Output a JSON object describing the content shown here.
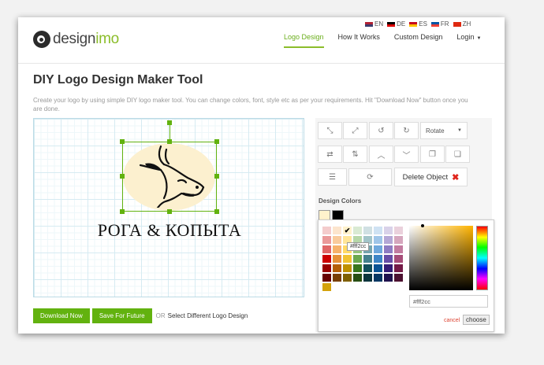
{
  "languages": [
    {
      "code": "EN",
      "colors": [
        "#b22234",
        "#3c3b6e"
      ]
    },
    {
      "code": "DE",
      "colors": [
        "#000000",
        "#dd0000"
      ]
    },
    {
      "code": "ES",
      "colors": [
        "#c60b1e",
        "#ffc400"
      ]
    },
    {
      "code": "FR",
      "colors": [
        "#0055a4",
        "#ef4135"
      ]
    },
    {
      "code": "ZH",
      "colors": [
        "#de2910",
        "#de2910"
      ]
    }
  ],
  "brand": {
    "part1": "design",
    "part2": "imo",
    "color_primary": "#444444",
    "color_accent": "#8bbd2a"
  },
  "nav": {
    "items": [
      "Logo Design",
      "How It Works",
      "Custom Design",
      "Login"
    ],
    "active": 0
  },
  "page": {
    "title": "DIY Logo Design Maker Tool",
    "description": "Create your logo by using simple DIY logo maker tool. You can change colors, font, style etc as per your requirements. Hit \"Download Now\" button once you are done."
  },
  "canvas": {
    "logo_text": "РОГА & КОПЫТА",
    "ellipse_color": "#fff2cc"
  },
  "buttons": {
    "download": "Download Now",
    "save": "Save For Future",
    "or": "OR",
    "select_different": "Select Different Logo Design"
  },
  "toolbar": {
    "rotate_label": "Rotate",
    "delete_label": "Delete Object",
    "icons": [
      "shrink-icon",
      "expand-icon",
      "rotate-left-icon",
      "rotate-right-icon",
      "flip-horizontal-icon",
      "flip-vertical-icon",
      "move-up-icon",
      "move-down-icon",
      "bring-forward-icon",
      "send-backward-icon",
      "align-center-icon",
      "refresh-icon"
    ]
  },
  "design_colors": {
    "label": "Design Colors",
    "swatches": [
      "#fff2cc",
      "#000000"
    ]
  },
  "color_picker": {
    "tooltip": "#fff2cc",
    "hex_value": "#fff2cc",
    "cancel": "cancel",
    "choose": "choose",
    "palette": [
      "#f4cccc",
      "#fce5cd",
      "#fff2cc",
      "#d9ead3",
      "#d0e0e3",
      "#cfe2f3",
      "#d9d2e9",
      "#ead1dc",
      "#ea9999",
      "#f9cb9c",
      "#ffe599",
      "#b6d7a8",
      "#a2c4c9",
      "#9fc5e8",
      "#b4a7d6",
      "#d5a6bd",
      "#e06666",
      "#f6b26b",
      "#ffd966",
      "#93c47d",
      "#76a5af",
      "#6fa8dc",
      "#8e7cc3",
      "#c27ba0",
      "#cc0000",
      "#e69138",
      "#f1c232",
      "#6aa84f",
      "#45818e",
      "#3d85c6",
      "#674ea7",
      "#a64d79",
      "#990000",
      "#b45f06",
      "#bf9000",
      "#38761d",
      "#134f5c",
      "#0b5394",
      "#351c75",
      "#741b47",
      "#660000",
      "#783f04",
      "#7f6000",
      "#274e13",
      "#0c343d",
      "#073763",
      "#20124d",
      "#4c1130",
      "#d4a20c"
    ],
    "selected_index": 2
  }
}
